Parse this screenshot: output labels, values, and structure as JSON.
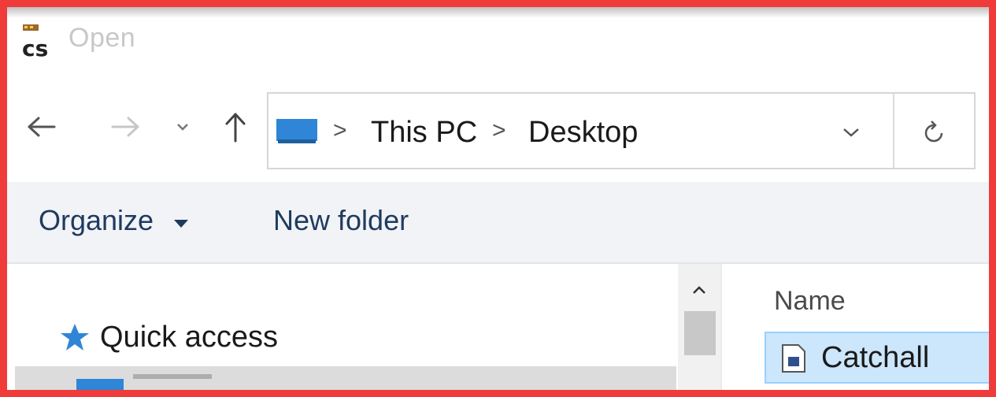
{
  "window": {
    "title": "Open",
    "icon": "cs-app-icon"
  },
  "nav": {
    "back_icon": "arrow-left-icon",
    "forward_icon": "arrow-right-icon",
    "recent_icon": "chevron-down-icon",
    "up_icon": "arrow-up-icon"
  },
  "address": {
    "location_icon": "this-pc-icon",
    "separator": ">",
    "crumbs": [
      "This PC",
      "Desktop"
    ],
    "dropdown_icon": "chevron-down-icon",
    "refresh_icon": "refresh-icon"
  },
  "toolbar": {
    "organize_label": "Organize",
    "new_folder_label": "New folder"
  },
  "navigation_pane": {
    "items": [
      {
        "label": "Quick access",
        "icon": "star-icon"
      }
    ]
  },
  "file_list": {
    "column_name": "Name",
    "rows": [
      {
        "name": "Catchall",
        "icon": "file-icon",
        "selected": true
      }
    ]
  },
  "colors": {
    "frame_border": "#f03b3b",
    "accent": "#2f86d6",
    "selection": "#cce6fb"
  }
}
